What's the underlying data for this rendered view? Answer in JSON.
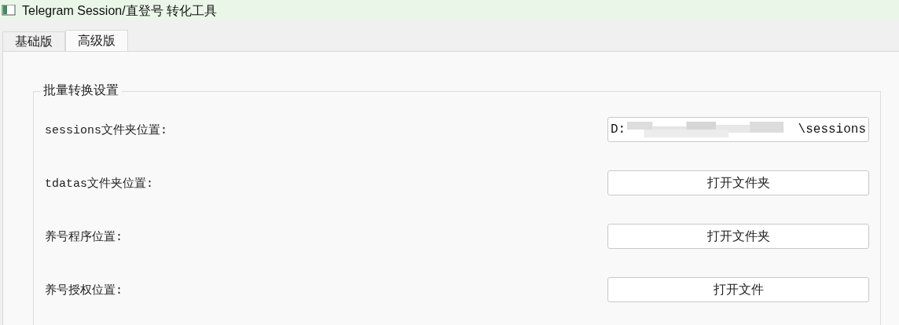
{
  "window": {
    "title": "Telegram Session/直登号 转化工具"
  },
  "tabs": [
    {
      "label": "基础版",
      "selected": false
    },
    {
      "label": "高级版",
      "selected": true
    }
  ],
  "group": {
    "title": "批量转换设置",
    "rows": [
      {
        "kind": "field",
        "label": "sessions文件夹位置:",
        "value_start": "D:",
        "value_end": "\\sessions"
      },
      {
        "kind": "button",
        "label": "tdatas文件夹位置:",
        "button": "打开文件夹"
      },
      {
        "kind": "button",
        "label": "养号程序位置:",
        "button": "打开文件夹"
      },
      {
        "kind": "button",
        "label": "养号授权位置:",
        "button": "打开文件"
      }
    ]
  }
}
